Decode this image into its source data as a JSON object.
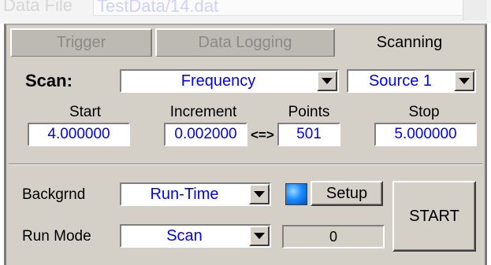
{
  "top": {
    "label": "Data File",
    "value": "TestData/14.dat"
  },
  "tabs": [
    {
      "label": "Trigger",
      "mnemonic": "T",
      "active": false
    },
    {
      "label": "Data Logging",
      "mnemonic": "L",
      "active": false
    },
    {
      "label": "Scanning",
      "mnemonic": "S",
      "active": true
    }
  ],
  "scan": {
    "label": "Scan:",
    "type": "Frequency",
    "source": "Source 1",
    "columns": {
      "start": "Start",
      "increment": "Increment",
      "points": "Points",
      "stop": "Stop"
    },
    "values": {
      "start": "4.000000",
      "increment": "0.002000",
      "points": "501",
      "stop": "5.000000"
    },
    "swap_symbol": "<=>"
  },
  "bottom": {
    "backgrnd_label": "Backgrnd",
    "backgrnd_value": "Run-Time",
    "run_mode_label": "Run Mode",
    "run_mode_value": "Scan",
    "setup_label": "Setup",
    "start_label": "START",
    "counter": "0"
  },
  "colors": {
    "panel": "#d4d0c8",
    "value_text": "#0000ff",
    "led": "#1a8cff"
  },
  "icons": [
    "dropdown-arrow-icon",
    "status-led-icon"
  ]
}
